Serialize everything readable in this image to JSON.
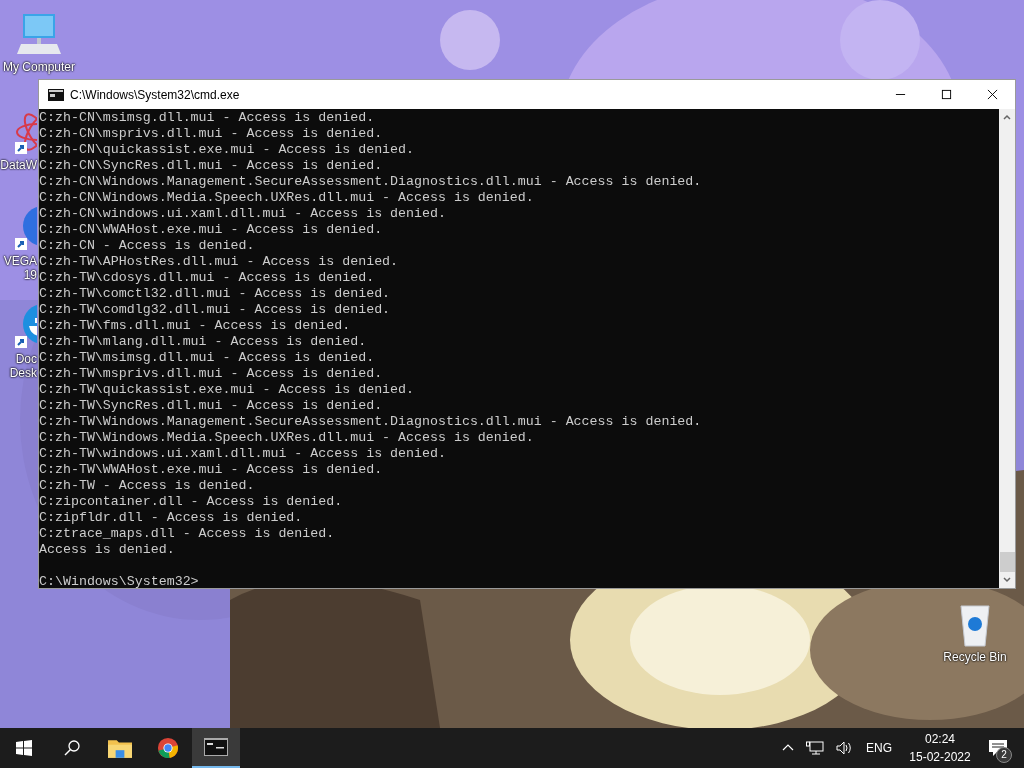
{
  "desktop_icons": [
    {
      "kind": "computer",
      "lines": [
        "My Computer"
      ],
      "shortcut": false
    },
    {
      "kind": "atom",
      "lines": [
        "DataW"
      ],
      "shortcut": true
    },
    {
      "kind": "vega",
      "lines": [
        "VEGA",
        "19"
      ],
      "shortcut": true
    },
    {
      "kind": "docker",
      "lines": [
        "Doc",
        "Desk"
      ],
      "shortcut": true
    },
    {
      "kind": "recycle",
      "lines": [
        "Recycle Bin"
      ],
      "shortcut": false
    }
  ],
  "window": {
    "title": "C:\\Windows\\System32\\cmd.exe",
    "lines": [
      "C:zh-CN\\msimsg.dll.mui - Access is denied.",
      "C:zh-CN\\msprivs.dll.mui - Access is denied.",
      "C:zh-CN\\quickassist.exe.mui - Access is denied.",
      "C:zh-CN\\SyncRes.dll.mui - Access is denied.",
      "C:zh-CN\\Windows.Management.SecureAssessment.Diagnostics.dll.mui - Access is denied.",
      "C:zh-CN\\Windows.Media.Speech.UXRes.dll.mui - Access is denied.",
      "C:zh-CN\\windows.ui.xaml.dll.mui - Access is denied.",
      "C:zh-CN\\WWAHost.exe.mui - Access is denied.",
      "C:zh-CN - Access is denied.",
      "C:zh-TW\\APHostRes.dll.mui - Access is denied.",
      "C:zh-TW\\cdosys.dll.mui - Access is denied.",
      "C:zh-TW\\comctl32.dll.mui - Access is denied.",
      "C:zh-TW\\comdlg32.dll.mui - Access is denied.",
      "C:zh-TW\\fms.dll.mui - Access is denied.",
      "C:zh-TW\\mlang.dll.mui - Access is denied.",
      "C:zh-TW\\msimsg.dll.mui - Access is denied.",
      "C:zh-TW\\msprivs.dll.mui - Access is denied.",
      "C:zh-TW\\quickassist.exe.mui - Access is denied.",
      "C:zh-TW\\SyncRes.dll.mui - Access is denied.",
      "C:zh-TW\\Windows.Management.SecureAssessment.Diagnostics.dll.mui - Access is denied.",
      "C:zh-TW\\Windows.Media.Speech.UXRes.dll.mui - Access is denied.",
      "C:zh-TW\\windows.ui.xaml.dll.mui - Access is denied.",
      "C:zh-TW\\WWAHost.exe.mui - Access is denied.",
      "C:zh-TW - Access is denied.",
      "C:zipcontainer.dll - Access is denied.",
      "C:zipfldr.dll - Access is denied.",
      "C:ztrace_maps.dll - Access is denied.",
      "Access is denied."
    ],
    "prompt": "C:\\Windows\\System32>"
  },
  "taskbar": {
    "apps": [
      {
        "kind": "start",
        "active": false
      },
      {
        "kind": "search",
        "active": false
      },
      {
        "kind": "folder",
        "active": false
      },
      {
        "kind": "chrome",
        "active": false
      },
      {
        "kind": "terminal",
        "active": true
      }
    ],
    "language": "ENG",
    "time": "02:24",
    "date": "15-02-2022",
    "notifications": "2"
  }
}
